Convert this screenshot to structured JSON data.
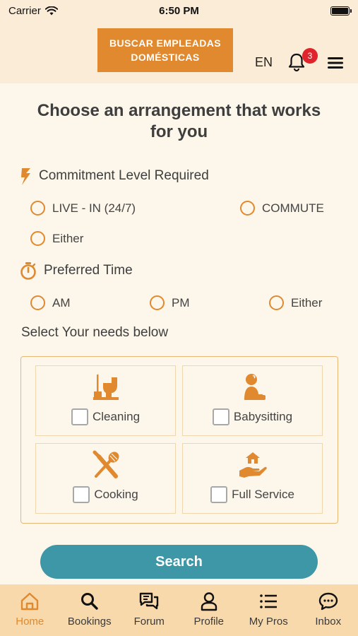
{
  "status_bar": {
    "carrier": "Carrier",
    "time": "6:50 PM"
  },
  "header": {
    "brand_label": "BUSCAR EMPLEADAS DOMÉSTICAS",
    "language": "EN",
    "notifications_count": "3"
  },
  "title": "Choose an arrangement that works for you",
  "commitment": {
    "label": "Commitment Level Required",
    "options": [
      "LIVE - IN (24/7)",
      "COMMUTE",
      "Either"
    ]
  },
  "preferred_time": {
    "label": "Preferred Time",
    "options": [
      "AM",
      "PM",
      "Either"
    ]
  },
  "needs": {
    "label": "Select Your needs below",
    "items": [
      {
        "label": "Cleaning",
        "icon": "cleaning-icon"
      },
      {
        "label": "Babysitting",
        "icon": "baby-icon"
      },
      {
        "label": "Cooking",
        "icon": "cooking-icon"
      },
      {
        "label": "Full Service",
        "icon": "full-service-icon"
      }
    ]
  },
  "search_button": "Search",
  "tabs": [
    {
      "label": "Home",
      "icon": "home-icon",
      "active": true
    },
    {
      "label": "Bookings",
      "icon": "search-icon"
    },
    {
      "label": "Forum",
      "icon": "chat-icon"
    },
    {
      "label": "Profile",
      "icon": "user-icon"
    },
    {
      "label": "My Pros",
      "icon": "list-icon"
    },
    {
      "label": "Inbox",
      "icon": "message-icon"
    }
  ],
  "colors": {
    "accent": "#e0892f",
    "button": "#3e97a7",
    "background": "#fdf6ea",
    "tabbar": "#f8d9ab"
  }
}
